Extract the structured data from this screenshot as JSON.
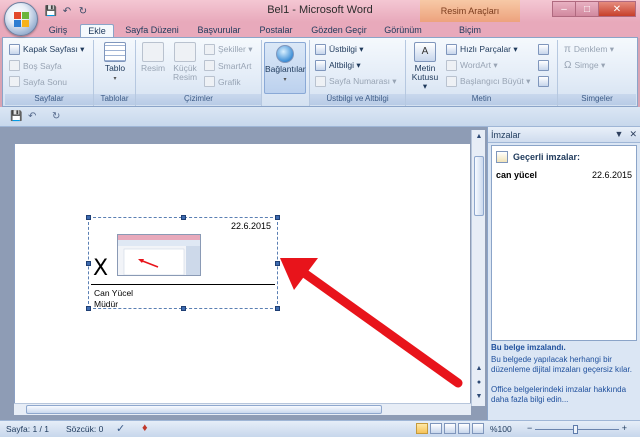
{
  "window": {
    "title": "Bel1 - Microsoft Word",
    "context_tab_group": "Resim Araçları",
    "controls": {
      "minimize": "–",
      "maximize": "□",
      "close": "✕"
    }
  },
  "qat": {
    "save": "💾",
    "undo": "↶",
    "redo": "↻"
  },
  "tabs": [
    {
      "label": "Giriş"
    },
    {
      "label": "Ekle",
      "active": true
    },
    {
      "label": "Sayfa Düzeni"
    },
    {
      "label": "Başvurular"
    },
    {
      "label": "Postalar"
    },
    {
      "label": "Gözden Geçir"
    },
    {
      "label": "Görünüm"
    },
    {
      "label": "Biçim"
    }
  ],
  "ribbon": {
    "sayfalar": {
      "label": "Sayfalar",
      "items": [
        "Kapak Sayfası ▾",
        "Boş Sayfa",
        "Sayfa Sonu"
      ]
    },
    "tablolar": {
      "label": "Tablolar",
      "table": "Tablo"
    },
    "cizimler": {
      "label": "Çizimler",
      "resim": "Resim",
      "kucuk_resim_1": "Küçük",
      "kucuk_resim_2": "Resim",
      "items": [
        "Şekiller ▾",
        "SmartArt",
        "Grafik"
      ]
    },
    "baglantilar": {
      "label": "Bağlantılar"
    },
    "ustbilgi": {
      "label": "Üstbilgi ve Altbilgi",
      "items": [
        "Üstbilgi ▾",
        "Altbilgi ▾",
        "Sayfa Numarası ▾"
      ]
    },
    "metin": {
      "label": "Metin",
      "metin_kutusu_1": "Metin",
      "metin_kutusu_2": "Kutusu ▾",
      "items": [
        "Hızlı Parçalar ▾",
        "WordArt ▾",
        "Başlangıcı Büyüt ▾"
      ]
    },
    "simgeler": {
      "label": "Simgeler",
      "items": [
        "Denklem ▾",
        "Simge ▾"
      ]
    }
  },
  "document": {
    "signature": {
      "date": "22.6.2015",
      "x_mark": "X",
      "name": "Can Yücel",
      "title": "Müdür"
    }
  },
  "task_pane": {
    "title": "İmzalar",
    "valid_header": "Geçerli imzalar:",
    "signer": "can yücel",
    "signed_date": "22.6.2015",
    "signed_notice": "Bu belge imzalandı.",
    "warning": "Bu belgede yapılacak herhangi bir düzenleme dijital imzaları geçersiz kılar.",
    "more_info": "Office belgelerindeki imzalar hakkında daha fazla bilgi edin..."
  },
  "status": {
    "page": "Sayfa: 1 / 1",
    "words": "Sözcük: 0",
    "zoom": "%100",
    "zoom_minus": "−",
    "zoom_plus": "+"
  },
  "colors": {
    "title_bar": "#e8a9bb",
    "ribbon_bg": "#e3ecf7",
    "annotation_arrow": "#e8141b",
    "context_tab": "#eda27d"
  }
}
